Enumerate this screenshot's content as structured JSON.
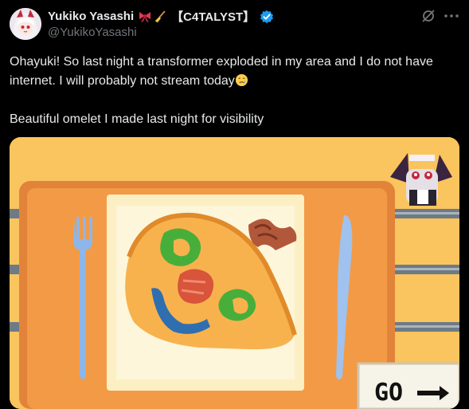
{
  "author": {
    "display_name": "Yukiko Yasashi",
    "tag": "【C4TALYST】",
    "handle": "@YukikoYasashi",
    "verified": true,
    "icons": [
      "ribbon-emoji",
      "broom-emoji",
      "verified-badge-icon"
    ]
  },
  "toolbar": {
    "grok_icon": "grok-icon",
    "more_icon": "more-icon"
  },
  "tweet": {
    "line1": "Ohayuki! So last night a transformer exploded in my area and I do not have internet. I will probably not stream today",
    "line1_emoji": "crying-face-emoji",
    "line2": "Beautiful omelet I made last night for visibility"
  },
  "media": {
    "sign_text": "GO",
    "colors": {
      "background": "#fac45e",
      "tray": "#f39a46",
      "plate": "#fcefc4",
      "omelet": "#f7b24e",
      "pepper": "#48ae3a",
      "ham": "#d8543a",
      "fish": "#2f6fb0"
    }
  }
}
